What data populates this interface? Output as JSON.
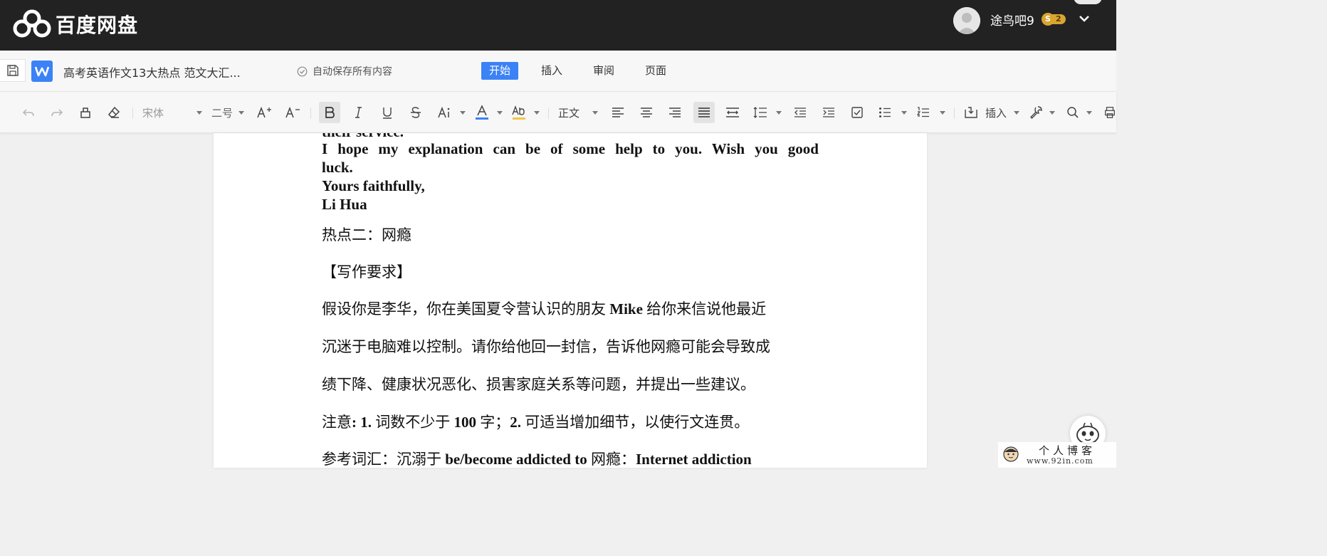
{
  "app": {
    "name": "百度网盘"
  },
  "user": {
    "name": "途鸟吧9",
    "coin_symbol": "S",
    "level": "2"
  },
  "document": {
    "title": "高考英语作文13大热点 范文大汇...",
    "autosave_text": "自动保存所有内容"
  },
  "menu": {
    "tabs": [
      "开始",
      "插入",
      "审阅",
      "页面"
    ],
    "active": "开始"
  },
  "toolbar": {
    "font_name": "宋体",
    "font_size": "二号",
    "style": "正文",
    "insert_label": "插入"
  },
  "content": {
    "cut_line": "their service.",
    "english_lines": [
      "I hope my explanation can be of some help to you. Wish you good",
      "luck.",
      "Yours faithfully,",
      "Li Hua"
    ],
    "hotspot_heading": "热点二：网瘾",
    "requirement_heading": "【写作要求】",
    "paragraph1": {
      "line1_pre": "假设你是李华，你在美国夏令营认识的朋友",
      "line1_bold": " Mike ",
      "line1_post": "给你来信说他最近",
      "line2": "沉迷于电脑难以控制。请你给他回一封信，告诉他网瘾可能会导致成",
      "line3": "绩下降、健康状况恶化、损害家庭关系等问题，并提出一些建议。"
    },
    "note": {
      "prefix": "注意",
      "colon_num1": ": 1.",
      "part1a": " 词数不少于 ",
      "num100": "100",
      "part1b": " 字；",
      "num2": "2.",
      "part2": " 可适当增加细节，以使行文连贯。"
    },
    "vocab": {
      "prefix": "参考词汇：沉溺于 ",
      "term1": "be/become addicted to",
      "mid": "  网瘾：",
      "term2": "Internet addiction"
    }
  },
  "watermark": {
    "title": "个人博客",
    "url": "www.92in.com"
  }
}
